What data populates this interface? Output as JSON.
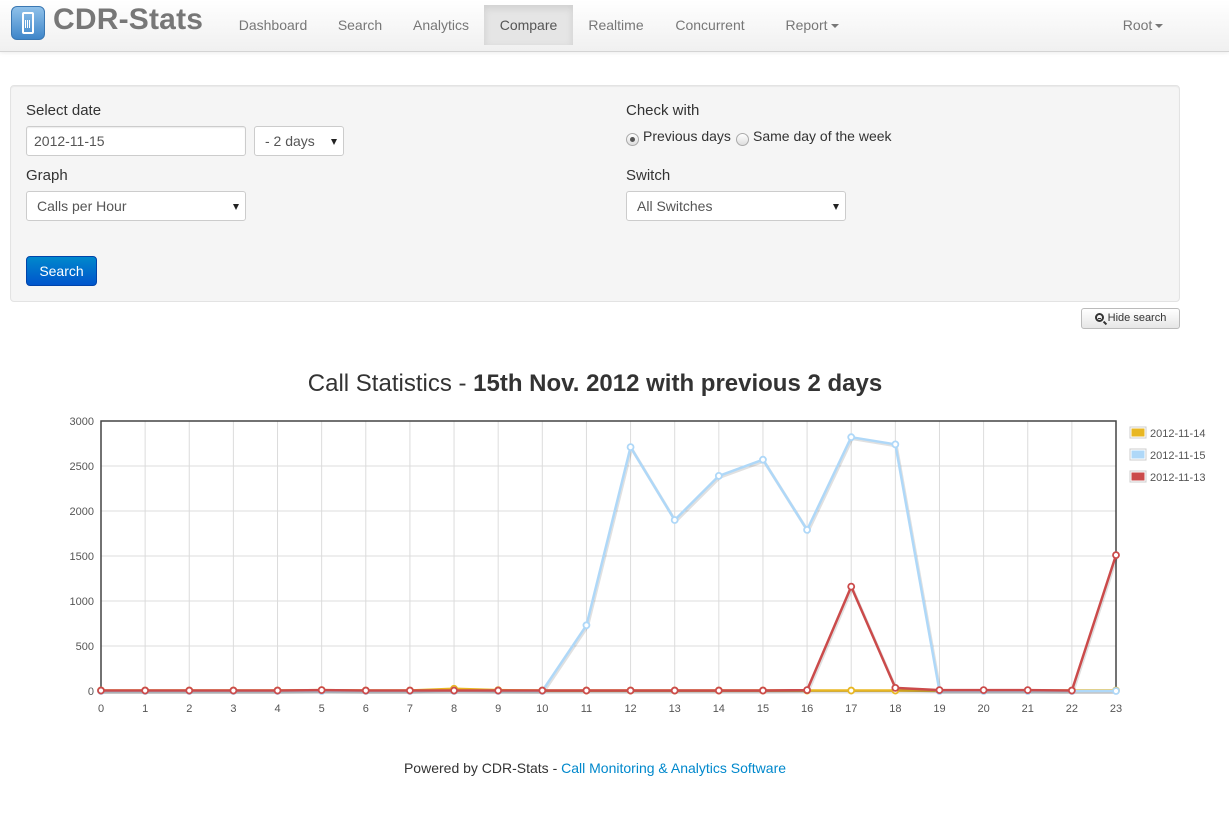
{
  "navbar": {
    "brand": "CDR-Stats",
    "items": [
      {
        "label": "Dashboard"
      },
      {
        "label": "Search"
      },
      {
        "label": "Analytics"
      },
      {
        "label": "Compare"
      },
      {
        "label": "Realtime"
      },
      {
        "label": "Concurrent"
      },
      {
        "label": "Report"
      }
    ],
    "user": "Root"
  },
  "search": {
    "select_date_label": "Select date",
    "date_value": "2012-11-15",
    "days_value": "- 2 days",
    "graph_label": "Graph",
    "graph_value": "Calls per Hour",
    "check_with_label": "Check with",
    "option_previous": "Previous days",
    "option_same_day": "Same day of the week",
    "switch_label": "Switch",
    "switch_value": "All Switches",
    "search_button": "Search",
    "hide_button": "Hide search"
  },
  "chart_title": {
    "prefix": "Call Statistics - ",
    "bold": "15th Nov. 2012 with previous 2 days"
  },
  "colors": {
    "series_2012_11_14": "#e8b723",
    "series_2012_11_15": "#afd8f8",
    "series_2012_11_13": "#cb4b4b",
    "link": "#0088cc"
  },
  "chart_data": {
    "type": "line",
    "title": "Call Statistics - 15th Nov. 2012 with previous 2 days",
    "x": [
      0,
      1,
      2,
      3,
      4,
      5,
      6,
      7,
      8,
      9,
      10,
      11,
      12,
      13,
      14,
      15,
      16,
      17,
      18,
      19,
      20,
      21,
      22,
      23
    ],
    "ylim": [
      0,
      3000
    ],
    "yticks": [
      0,
      500,
      1000,
      1500,
      2000,
      2500,
      3000
    ],
    "grid": true,
    "legend_position": "right",
    "series": [
      {
        "name": "2012-11-14",
        "color": "#e8b723",
        "values": [
          5,
          5,
          5,
          5,
          5,
          10,
          5,
          5,
          25,
          10,
          5,
          5,
          5,
          5,
          5,
          5,
          5,
          5,
          5,
          5,
          5,
          5,
          5,
          5
        ]
      },
      {
        "name": "2012-11-15",
        "color": "#afd8f8",
        "values": [
          0,
          0,
          0,
          0,
          0,
          0,
          0,
          0,
          0,
          0,
          0,
          730,
          2710,
          1900,
          2390,
          2570,
          1790,
          2820,
          2740,
          0,
          0,
          0,
          0,
          0
        ]
      },
      {
        "name": "2012-11-13",
        "color": "#cb4b4b",
        "values": [
          5,
          5,
          5,
          5,
          5,
          10,
          5,
          5,
          5,
          5,
          5,
          5,
          5,
          5,
          5,
          5,
          10,
          1160,
          35,
          10,
          10,
          10,
          5,
          1510
        ]
      }
    ]
  },
  "footer": {
    "text": "Powered by CDR-Stats - ",
    "link": "Call Monitoring & Analytics Software"
  }
}
